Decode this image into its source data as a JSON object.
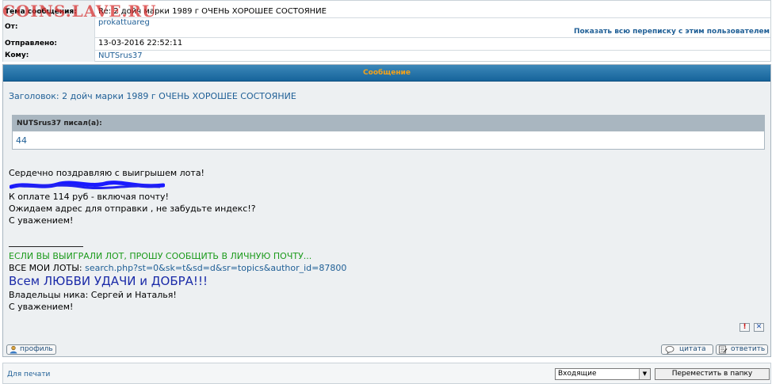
{
  "watermark": "COINS.LAVE.RU",
  "header": {
    "subject_label": "Тема сообщения:",
    "subject_value": "Re: 2 дойч марки 1989 г ОЧЕНЬ ХОРОШЕЕ СОСТОЯНИЕ",
    "from_label": "От:",
    "from_value": "prokattuareg",
    "show_correspondence": "Показать всю переписку с этим пользователем",
    "sent_label": "Отправлено:",
    "sent_value": "13-03-2016 22:52:11",
    "to_label": "Кому:",
    "to_value": "NUTSrus37"
  },
  "message": {
    "panel_title": "Сообщение",
    "subject_line": "Заголовок: 2 дойч марки 1989 г ОЧЕНЬ ХОРОШЕЕ СОСТОЯНИЕ",
    "quote": {
      "author": "NUTSrus37 писал(а):",
      "text": "44"
    },
    "body": [
      "Сердечно поздравляю с выигрышем лота!",
      "К оплате 114 руб - включая почту!",
      "Ожидаем адрес для отправки , не забудьте индекс!?",
      "С уважением!"
    ],
    "signature": {
      "notice": "ЕСЛИ ВЫ ВЫИГРАЛИ ЛОТ, ПРОШУ СООБЩИТЬ В ЛИЧНУЮ ПОЧТУ...",
      "lots_label": "ВСЕ МОИ ЛОТЫ:",
      "lots_link": "search.php?st=0&sk=t&sd=d&sr=topics&author_id=87800",
      "wish": "Всем ЛЮБВИ УДАЧИ и ДОБРА!!!",
      "owners": "Владельцы ника: Сергей и Наталья!",
      "regards": "С уважением!"
    }
  },
  "actions": {
    "report_icon": "!",
    "delete_icon": "✕",
    "profile": "профиль",
    "quote": "цитата",
    "reply": "ответить"
  },
  "footer": {
    "print": "Для печати",
    "folder_selected": "Входящие",
    "move_button": "Переместить в папку"
  }
}
